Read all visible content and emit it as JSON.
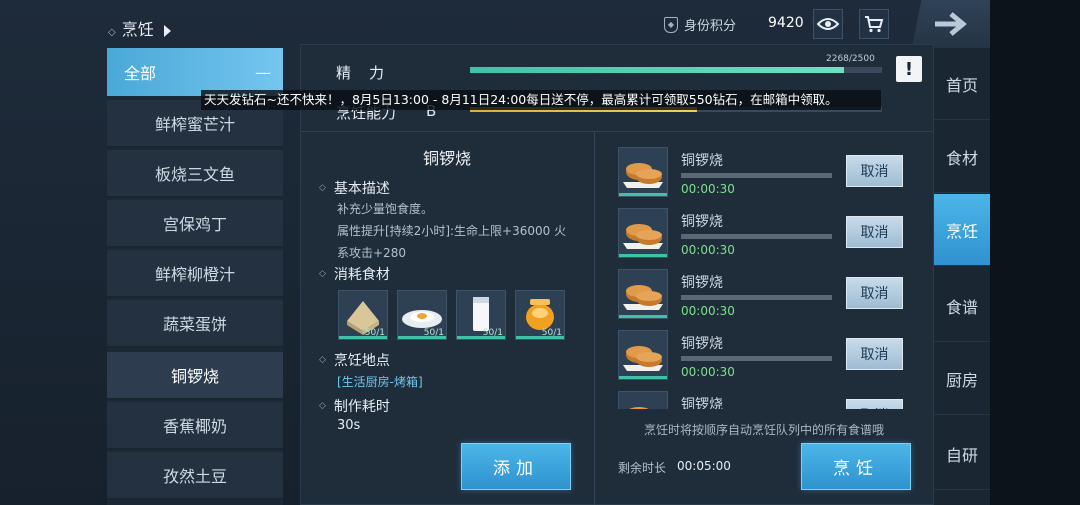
{
  "header": {
    "title": "烹饪",
    "identity_label": "身份积分",
    "identity_score": "9420"
  },
  "categories": {
    "all_label": "全部",
    "all_symbol": "—",
    "recipes": [
      "鲜榨蜜芒汁",
      "板烧三文鱼",
      "宫保鸡丁",
      "鲜榨柳橙汁",
      "蔬菜蛋饼",
      "铜锣烧",
      "香蕉椰奶",
      "孜然土豆"
    ],
    "selected": "铜锣烧"
  },
  "stats": {
    "energy_label": "精力",
    "energy_value": "2268/2500",
    "energy_fraction": 0.907,
    "skill_label": "烹饪能力",
    "skill_grade": "B",
    "skill_fraction": 0.55
  },
  "marquee": "天天发钻石~还不快来！，8月5日13:00 - 8月11日24:00每日送不停，最高累计可领取550钻石，在邮箱中领取。",
  "detail": {
    "dish_name": "铜锣烧",
    "basic_desc_title": "基本描述",
    "desc_line1": "补充少量饱食度。",
    "desc_line2": "属性提升[持续2小时]:生命上限+36000 火",
    "desc_line3": "系攻击+280",
    "ingredients_title": "消耗食材",
    "ingredients": [
      {
        "icon": "flour-sack-icon",
        "count": "50/1"
      },
      {
        "icon": "fried-egg-icon",
        "count": "50/1"
      },
      {
        "icon": "milk-glass-icon",
        "count": "50/1"
      },
      {
        "icon": "honey-jar-icon",
        "count": "50/1"
      }
    ],
    "location_title": "烹饪地点",
    "location_value": "[生活厨房-烤箱]",
    "time_title": "制作耗时",
    "time_value": "30s",
    "add_label": "添加"
  },
  "queue": {
    "items": [
      {
        "name": "铜锣烧",
        "time": "00:00:30",
        "cancel": "取消"
      },
      {
        "name": "铜锣烧",
        "time": "00:00:30",
        "cancel": "取消"
      },
      {
        "name": "铜锣烧",
        "time": "00:00:30",
        "cancel": "取消"
      },
      {
        "name": "铜锣烧",
        "time": "00:00:30",
        "cancel": "取消"
      },
      {
        "name": "铜锣烧",
        "time": "",
        "cancel": "取消"
      }
    ],
    "hint": "烹饪时将按顺序自动烹饪队列中的所有食谱哦",
    "remain_label": "剩余时长",
    "remain_value": "00:05:00",
    "cook_label": "烹饪"
  },
  "nav": {
    "items": [
      "首页",
      "食材",
      "烹饪",
      "食谱",
      "厨房",
      "自研"
    ],
    "active": "烹饪"
  },
  "colors": {
    "accent_blue": "#4bb6e8",
    "energy_green": "#3fc2a6",
    "skill_yellow": "#d8b23a",
    "timer_green": "#7ee08c"
  }
}
